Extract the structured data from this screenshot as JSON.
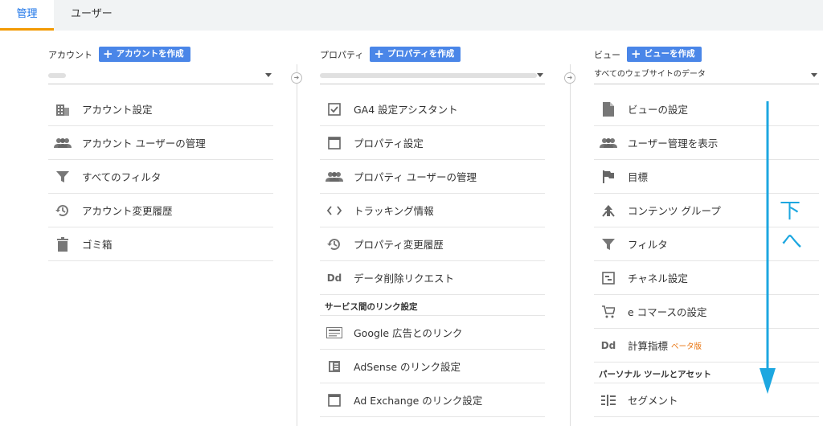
{
  "tabs": [
    {
      "label": "管理",
      "active": true
    },
    {
      "label": "ユーザー",
      "active": false
    }
  ],
  "account": {
    "label": "アカウント",
    "create_label": "アカウントを作成",
    "items": [
      {
        "icon": "building-icon",
        "label": "アカウント設定"
      },
      {
        "icon": "people-icon",
        "label": "アカウント ユーザーの管理"
      },
      {
        "icon": "filter-icon",
        "label": "すべてのフィルタ"
      },
      {
        "icon": "history-icon",
        "label": "アカウント変更履歴"
      },
      {
        "icon": "trash-icon",
        "label": "ゴミ箱"
      }
    ]
  },
  "property": {
    "label": "プロパティ",
    "create_label": "プロパティを作成",
    "items": [
      {
        "icon": "checkbox-icon",
        "label": "GA4 設定アシスタント"
      },
      {
        "icon": "window-icon",
        "label": "プロパティ設定"
      },
      {
        "icon": "people-icon",
        "label": "プロパティ ユーザーの管理"
      },
      {
        "icon": "code-icon",
        "label": "トラッキング情報"
      },
      {
        "icon": "history-icon",
        "label": "プロパティ変更履歴"
      },
      {
        "icon": "dd-icon",
        "label": "データ削除リクエスト"
      }
    ],
    "section_label": "サービス間のリンク設定",
    "link_items": [
      {
        "icon": "google-ads-icon",
        "label": "Google 広告とのリンク"
      },
      {
        "icon": "adsense-icon",
        "label": "AdSense のリンク設定"
      },
      {
        "icon": "window-icon",
        "label": "Ad Exchange のリンク設定"
      }
    ]
  },
  "view": {
    "label": "ビュー",
    "create_label": "ビューを作成",
    "selected": "すべてのウェブサイトのデータ",
    "items": [
      {
        "icon": "document-icon",
        "label": "ビューの設定"
      },
      {
        "icon": "people-icon",
        "label": "ユーザー管理を表示"
      },
      {
        "icon": "flag-icon",
        "label": "目標"
      },
      {
        "icon": "content-group-icon",
        "label": "コンテンツ グループ"
      },
      {
        "icon": "filter-icon",
        "label": "フィルタ"
      },
      {
        "icon": "channel-icon",
        "label": "チャネル設定"
      },
      {
        "icon": "cart-icon",
        "label": "e コマースの設定"
      },
      {
        "icon": "dd-icon",
        "label": "計算指標",
        "badge": "ベータ版"
      }
    ],
    "section_label": "パーソナル ツールとアセット",
    "tool_items": [
      {
        "icon": "segment-icon",
        "label": "セグメント"
      }
    ]
  },
  "overlay": {
    "text_line1": "下",
    "text_line2": "へ",
    "arrow_color": "#1da7e0"
  },
  "colors": {
    "accent": "#4a86e8",
    "tab_active": "#1a73e8",
    "tab_underline": "#f29900"
  }
}
